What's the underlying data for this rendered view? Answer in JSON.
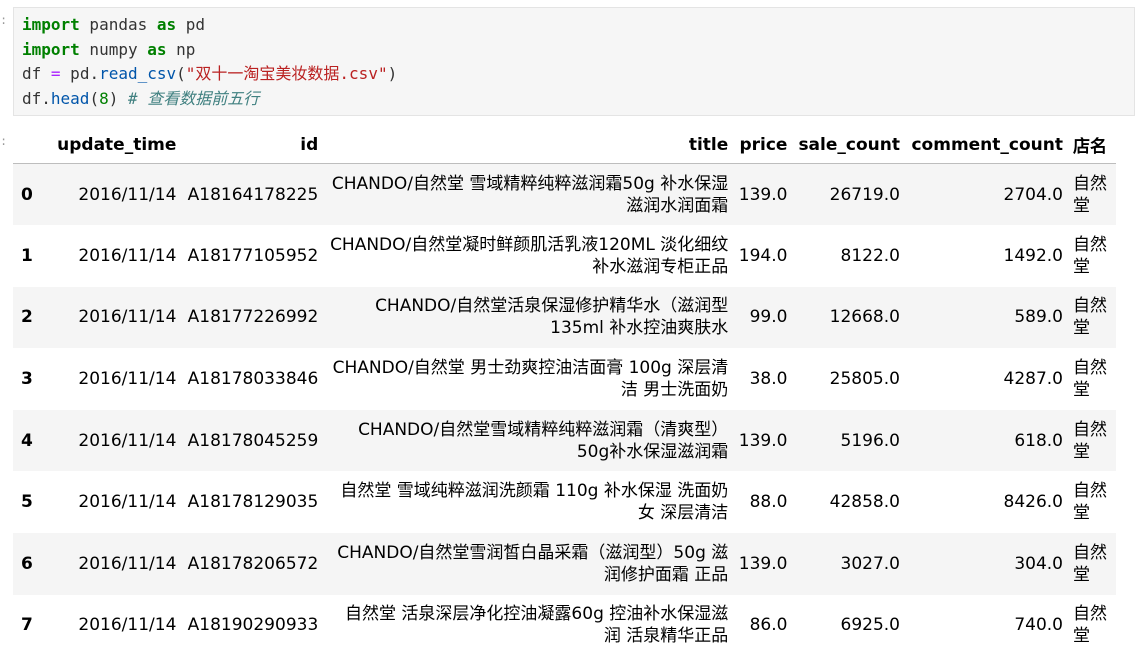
{
  "code_cell": {
    "lines": [
      [
        {
          "t": "import",
          "c": "kw"
        },
        {
          "t": " pandas ",
          "c": ""
        },
        {
          "t": "as",
          "c": "kw"
        },
        {
          "t": " pd",
          "c": ""
        }
      ],
      [
        {
          "t": "import",
          "c": "kw"
        },
        {
          "t": " numpy ",
          "c": ""
        },
        {
          "t": "as",
          "c": "kw"
        },
        {
          "t": " np",
          "c": ""
        }
      ],
      [
        {
          "t": "df ",
          "c": ""
        },
        {
          "t": "=",
          "c": "op"
        },
        {
          "t": " pd.",
          "c": ""
        },
        {
          "t": "read_csv",
          "c": "fn"
        },
        {
          "t": "(",
          "c": ""
        },
        {
          "t": "\"双十一淘宝美妆数据.csv\"",
          "c": "str"
        },
        {
          "t": ")",
          "c": ""
        }
      ],
      [
        {
          "t": "df.",
          "c": ""
        },
        {
          "t": "head",
          "c": "fn"
        },
        {
          "t": "(",
          "c": ""
        },
        {
          "t": "8",
          "c": "num"
        },
        {
          "t": ") ",
          "c": ""
        },
        {
          "t": "# 查看数据前五行",
          "c": "cm"
        }
      ]
    ]
  },
  "dataframe": {
    "columns": [
      "",
      "update_time",
      "id",
      "title",
      "price",
      "sale_count",
      "comment_count",
      "店名"
    ],
    "rows": [
      {
        "index": "0",
        "update_time": "2016/11/14",
        "id": "A18164178225",
        "title": "CHANDO/自然堂 雪域精粹纯粹滋润霜50g 补水保湿 滋润水润面霜",
        "price": "139.0",
        "sale_count": "26719.0",
        "comment_count": "2704.0",
        "shop": "自然堂"
      },
      {
        "index": "1",
        "update_time": "2016/11/14",
        "id": "A18177105952",
        "title": "CHANDO/自然堂凝时鲜颜肌活乳液120ML 淡化细纹补水滋润专柜正品",
        "price": "194.0",
        "sale_count": "8122.0",
        "comment_count": "1492.0",
        "shop": "自然堂"
      },
      {
        "index": "2",
        "update_time": "2016/11/14",
        "id": "A18177226992",
        "title": "CHANDO/自然堂活泉保湿修护精华水（滋润型135ml 补水控油爽肤水",
        "price": "99.0",
        "sale_count": "12668.0",
        "comment_count": "589.0",
        "shop": "自然堂"
      },
      {
        "index": "3",
        "update_time": "2016/11/14",
        "id": "A18178033846",
        "title": "CHANDO/自然堂 男士劲爽控油洁面膏 100g 深层清洁 男士洗面奶",
        "price": "38.0",
        "sale_count": "25805.0",
        "comment_count": "4287.0",
        "shop": "自然堂"
      },
      {
        "index": "4",
        "update_time": "2016/11/14",
        "id": "A18178045259",
        "title": "CHANDO/自然堂雪域精粹纯粹滋润霜（清爽型）50g补水保湿滋润霜",
        "price": "139.0",
        "sale_count": "5196.0",
        "comment_count": "618.0",
        "shop": "自然堂"
      },
      {
        "index": "5",
        "update_time": "2016/11/14",
        "id": "A18178129035",
        "title": "自然堂 雪域纯粹滋润洗颜霜 110g 补水保湿 洗面奶女 深层清洁",
        "price": "88.0",
        "sale_count": "42858.0",
        "comment_count": "8426.0",
        "shop": "自然堂"
      },
      {
        "index": "6",
        "update_time": "2016/11/14",
        "id": "A18178206572",
        "title": "CHANDO/自然堂雪润皙白晶采霜（滋润型）50g 滋润修护面霜 正品",
        "price": "139.0",
        "sale_count": "3027.0",
        "comment_count": "304.0",
        "shop": "自然堂"
      },
      {
        "index": "7",
        "update_time": "2016/11/14",
        "id": "A18190290933",
        "title": "自然堂 活泉深层净化控油凝露60g 控油补水保湿滋润 活泉精华正品",
        "price": "86.0",
        "sale_count": "6925.0",
        "comment_count": "740.0",
        "shop": "自然堂"
      }
    ]
  }
}
